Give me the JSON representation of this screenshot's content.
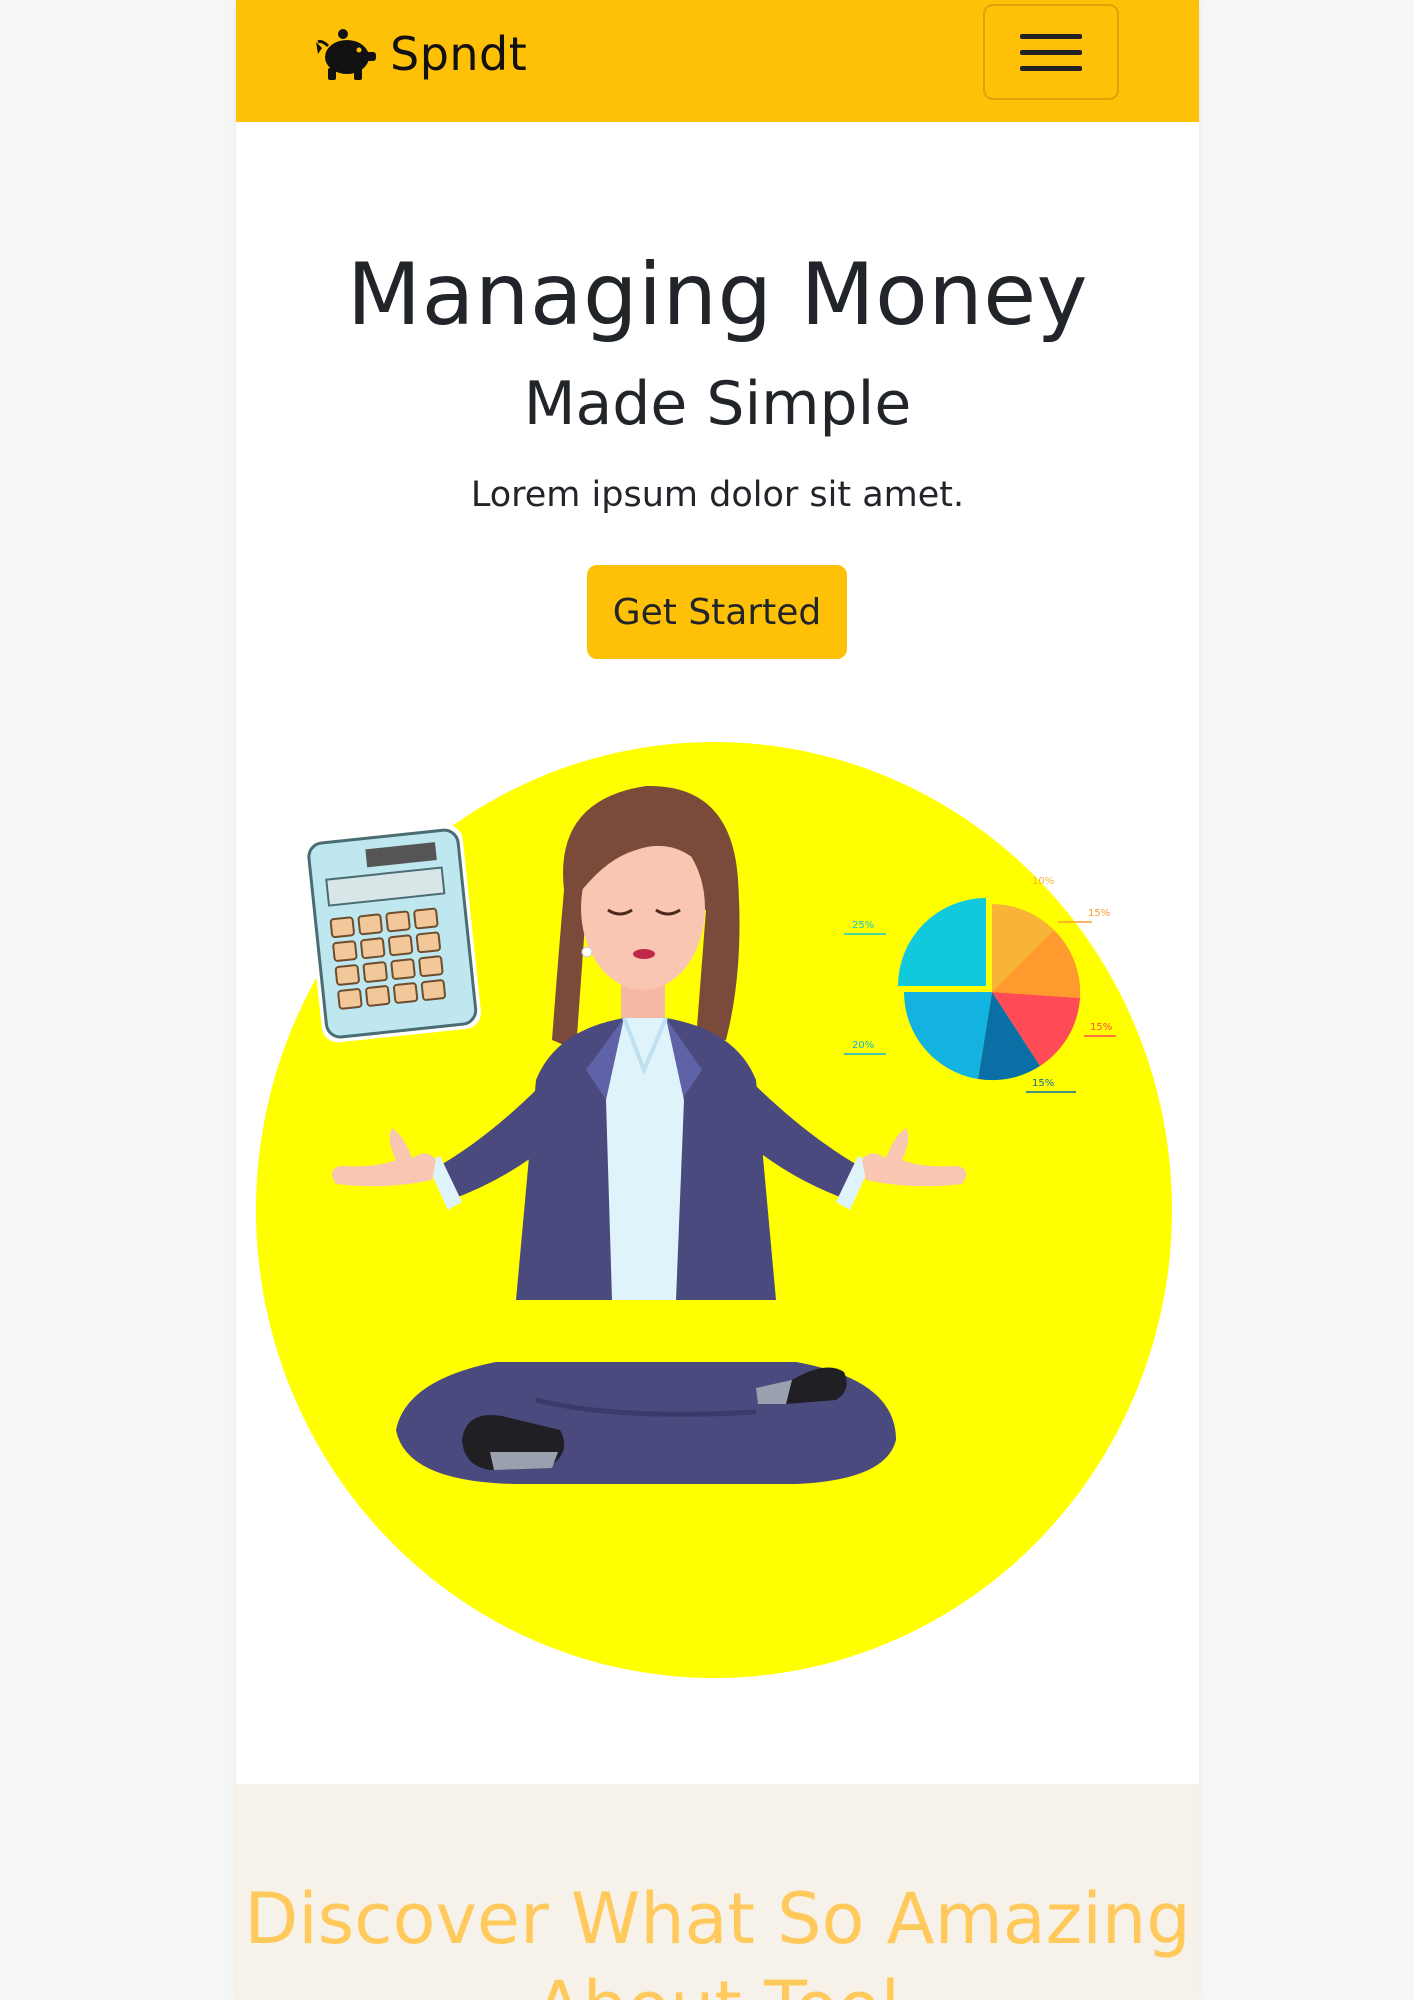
{
  "navbar": {
    "brand_name": "Spndt",
    "brand_icon": "piggy-bank-icon",
    "menu_icon": "hamburger-menu-icon",
    "background": "#ffc107"
  },
  "hero": {
    "title": "Managing Money",
    "subtitle": "Made Simple",
    "text": "Lorem ipsum dolor sit amet.",
    "cta_label": "Get Started",
    "cta_color": "#ffc107",
    "illustration": "woman-meditating-with-calculator-and-pie-chart",
    "circle_color": "#ffff00",
    "pie_labels": [
      "25%",
      "20%",
      "10%",
      "15%",
      "15%",
      "15%"
    ]
  },
  "features": {
    "title": "Discover What So Amazing About Tool",
    "title_color": "#ffc95c"
  }
}
